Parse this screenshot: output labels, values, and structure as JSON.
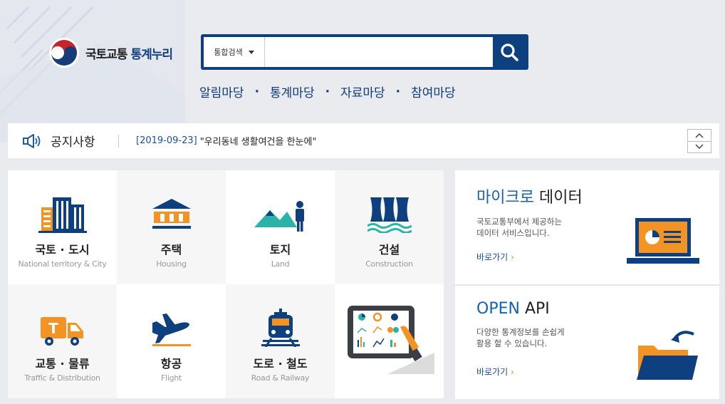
{
  "logo": {
    "name_plain": "국토교통 ",
    "name_highlight": "통계누리"
  },
  "search": {
    "scope": "통합검색",
    "placeholder": "",
    "value": ""
  },
  "nav": [
    "알림마당",
    "통계마당",
    "자료마당",
    "참여마당"
  ],
  "nav_separator": "·",
  "notice": {
    "title": "공지사항",
    "date": "[2019-09-23]",
    "text": "\"우리동네 생활여건을 한눈에\""
  },
  "categories": [
    {
      "ko": "국토 · 도시",
      "en": "National territory & City",
      "icon": "city-buildings-icon"
    },
    {
      "ko": "주택",
      "en": "Housing",
      "icon": "house-icon"
    },
    {
      "ko": "토지",
      "en": "Land",
      "icon": "land-icon"
    },
    {
      "ko": "건설",
      "en": "Construction",
      "icon": "construction-icon"
    },
    {
      "ko": "교통 · 물류",
      "en": "Traffic & Distribution",
      "icon": "truck-icon"
    },
    {
      "ko": "항공",
      "en": "Flight",
      "icon": "airplane-icon"
    },
    {
      "ko": "도로 · 철도",
      "en": "Road & Railway",
      "icon": "train-icon"
    }
  ],
  "cards": {
    "micro": {
      "title_highlight": "마이크로",
      "title_rest": " 데이터",
      "desc1": "국토교통부에서 제공하는",
      "desc2": "데이터 서비스입니다.",
      "link": "바로가기"
    },
    "api": {
      "title_highlight": "OPEN",
      "title_rest": " API",
      "desc1": "다양한 통계정보를 손쉽게",
      "desc2": "활용 할 수 있습니다.",
      "link": "바로가기"
    }
  },
  "colors": {
    "navy": "#0e3f7e",
    "orange": "#f39323",
    "teal": "#2bb3a8",
    "bg": "#e9ebee"
  }
}
